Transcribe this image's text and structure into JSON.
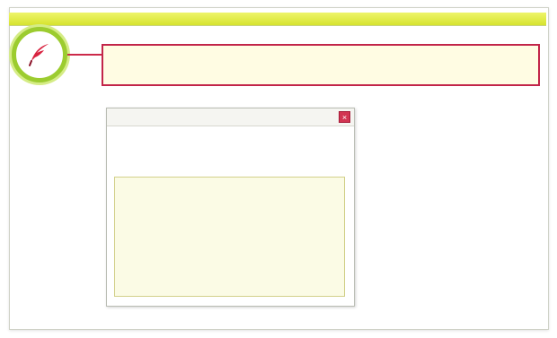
{
  "window": {
    "topbar_label": ""
  },
  "callout": {
    "text": ""
  },
  "dialog": {
    "title": "",
    "close_glyph": "×",
    "instructions": "",
    "textarea_value": "",
    "textarea_placeholder": ""
  },
  "icons": {
    "badge": "quill-pen-icon",
    "close": "close-icon"
  },
  "colors": {
    "accent_green": "#9ccc2f",
    "topbar_yellow": "#d6e32f",
    "alert_red": "#c22549",
    "callout_bg": "#fffce3",
    "textarea_bg": "#fbfbe5"
  }
}
